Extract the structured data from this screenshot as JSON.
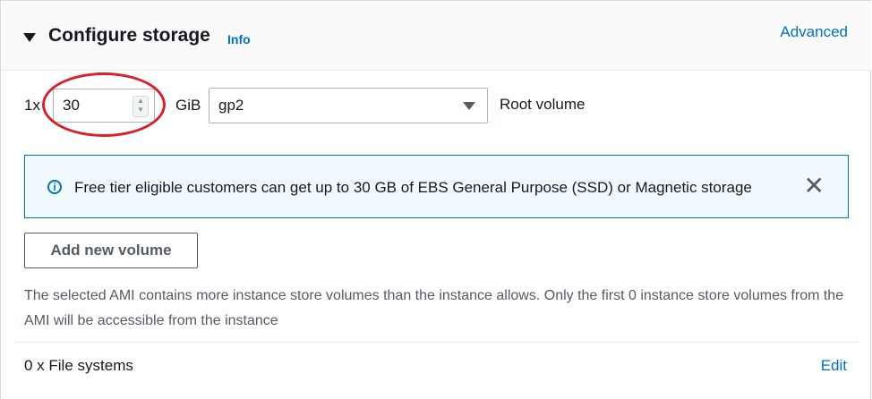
{
  "header": {
    "title": "Configure storage",
    "info_label": "Info",
    "advanced_label": "Advanced"
  },
  "volume": {
    "count_label": "1x",
    "size_value": "30",
    "unit_label": "GiB",
    "volume_type": "gp2",
    "volume_label": "Root volume"
  },
  "alert": {
    "icon": "info-icon",
    "text": "Free tier eligible customers can get up to 30 GB of EBS General Purpose (SSD) or Magnetic storage",
    "close_icon": "close-icon"
  },
  "actions": {
    "add_volume_label": "Add new volume"
  },
  "notice": {
    "text": "The selected AMI contains more instance store volumes than the instance allows. Only the first 0 instance store volumes from the AMI will be accessible from the instance"
  },
  "file_systems": {
    "label": "0 x File systems",
    "edit_label": "Edit"
  },
  "colors": {
    "link": "#0073bb",
    "alert_background": "#f1faff",
    "highlight": "#d8202d"
  }
}
